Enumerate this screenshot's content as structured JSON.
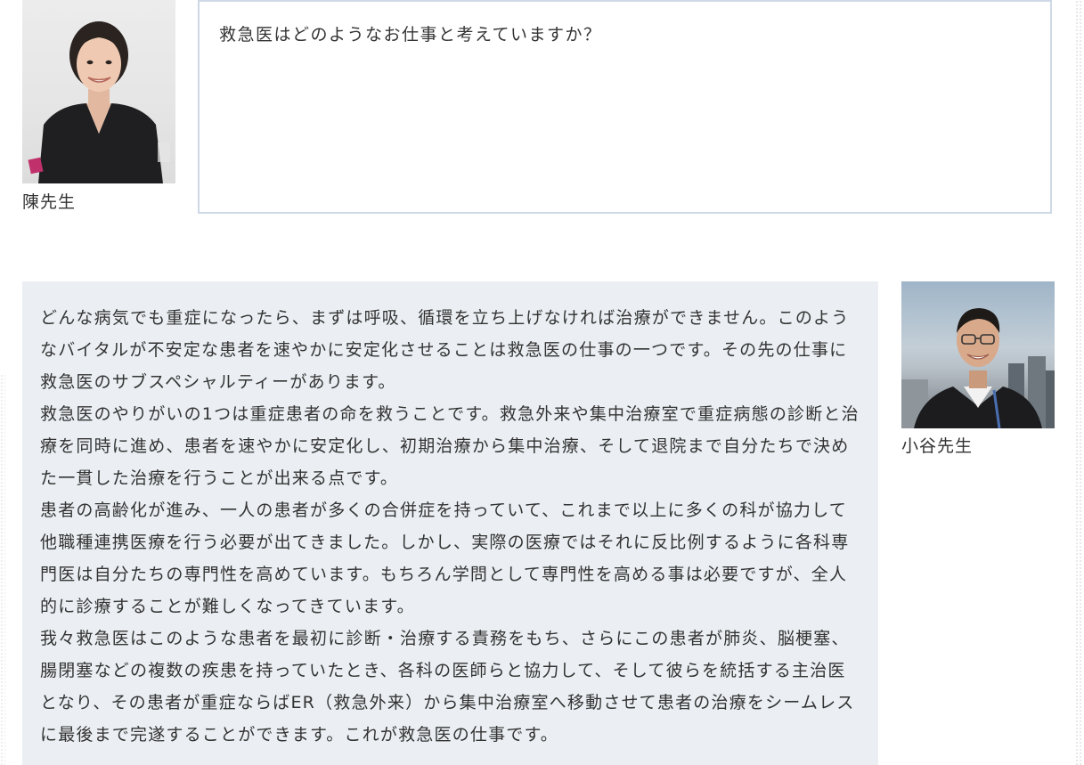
{
  "speaker1": {
    "name": "陳先生",
    "photo_icon": "person-photo"
  },
  "question": {
    "text": "救急医はどのようなお仕事と考えていますか？"
  },
  "speaker2": {
    "name": "小谷先生",
    "photo_icon": "person-photo"
  },
  "answer": {
    "paragraphs": [
      "どんな病気でも重症になったら、まずは呼吸、循環を立ち上げなければ治療ができません。このようなバイタルが不安定な患者を速やかに安定化させることは救急医の仕事の一つです。その先の仕事に救急医のサブスペシャルティーがあります。",
      "救急医のやりがいの1つは重症患者の命を救うことです。救急外来や集中治療室で重症病態の診断と治療を同時に進め、患者を速やかに安定化し、初期治療から集中治療、そして退院まで自分たちで決めた一貫した治療を行うことが出来る点です。",
      "患者の高齢化が進み、一人の患者が多くの合併症を持っていて、これまで以上に多くの科が協力して他職種連携医療を行う必要が出てきました。しかし、実際の医療ではそれに反比例するように各科専門医は自分たちの専門性を高めています。もちろん学問として専門性を高める事は必要ですが、全人的に診療することが難しくなってきています。",
      "我々救急医はこのような患者を最初に診断・治療する責務をもち、さらにこの患者が肺炎、脳梗塞、腸閉塞などの複数の疾患を持っていたとき、各科の医師らと協力して、そして彼らを統括する主治医となり、その患者が重症ならばER（救急外来）から集中治療室へ移動させて患者の治療をシームレスに最後まで完遂することができます。これが救急医の仕事です。"
    ]
  },
  "colors": {
    "answer_bg": "#ebeff3",
    "question_border": "#cfd9e6",
    "text": "#333333"
  }
}
